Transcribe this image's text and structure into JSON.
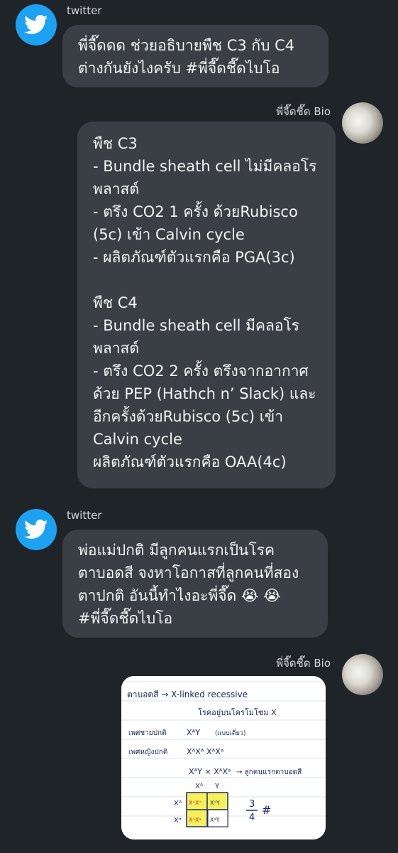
{
  "messages": [
    {
      "sender": "twitter",
      "text": "พี่จี๊ดดด ช่วยอธิบายพืช C3 กับ C4\nต่างกันยังไงครับ #พี่จี๊ดชี๊ดไบโอ"
    },
    {
      "sender": "พี่จี๊ดชี๊ด Bio",
      "text": "พืช C3\n- Bundle sheath cell ไม่มีคลอโร\nพลาสต์\n- ตรึง CO2 1 ครั้ง ด้วยRubisco\n(5c) เข้า Calvin cycle\n- ผลิตภัณฑ์ตัวแรกคือ PGA(3c)\n\nพืช C4\n- Bundle sheath cell มีคลอโร\nพลาสต์\n- ตรึง CO2 2 ครั้ง ตรึงจากอากาศ\nด้วย PEP (Hathch n’ Slack) และ\nอีกครั้งด้วยRubisco (5c) เข้า\nCalvin cycle\nผลิตภัณฑ์ตัวแรกคือ OAA(4c)"
    },
    {
      "sender": "twitter",
      "text": "พ่อแม่ปกติ มีลูกคนแรกเป็นโรค\nตาบอดสี จงหาโอกาสที่ลูกคนที่สอง\nตาปกติ อันนี้ทำไงอะพี่จี๊ด 😭 😭\n#พี่จี๊ดชี๊ดไบโอ"
    },
    {
      "sender": "พี่จี๊ดชี๊ด Bio",
      "note": {
        "line1": "ตาบอดสี → X-linked recessive",
        "line2": "โรคอยู่บนโครโมโซม X",
        "line3": "เพศชายปกติ",
        "line3_geno": "XᴬY",
        "line3_note": "(แบบเดี่ยว)",
        "line4": "เพศหญิงปกติ",
        "line4_geno": "XᴬXᴬ  XᴬXᵃ",
        "cross": "XᴬY × XᴬXᵃ",
        "cross_result": "→ ลูกคนแรกตาบอดสี",
        "col1": "Xᴬ",
        "col2": "Y",
        "row1": "Xᴬ",
        "row2": "Xᵃ",
        "cell11": "XᴬXᴬ",
        "cell12": "XᴬY",
        "cell21": "XᴬXᵃ",
        "cell22": "XᵃY",
        "fraction_num": "3",
        "fraction_den": "4",
        "hash": "#"
      }
    }
  ]
}
